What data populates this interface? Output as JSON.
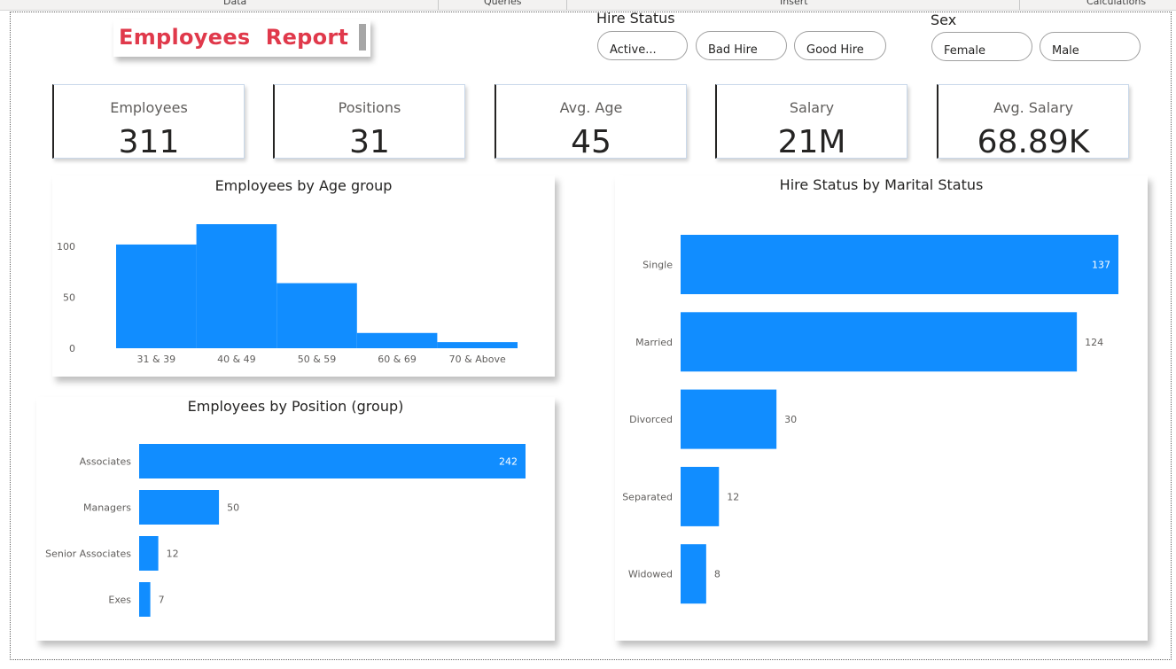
{
  "ribbon": {
    "tabs": [
      "Data",
      "Queries",
      "Insert",
      "Calculations"
    ]
  },
  "report": {
    "title": "Employees  Report"
  },
  "slicers": {
    "hire_status": {
      "title": "Hire Status",
      "options": [
        "Active...",
        "Bad Hire",
        "Good Hire"
      ]
    },
    "sex": {
      "title": "Sex",
      "options": [
        "Female",
        "Male"
      ]
    }
  },
  "kpis": [
    {
      "label": "Employees",
      "value": "311"
    },
    {
      "label": "Positions",
      "value": "31"
    },
    {
      "label": "Avg. Age",
      "value": "45"
    },
    {
      "label": "Salary",
      "value": "21M"
    },
    {
      "label": "Avg. Salary",
      "value": "68.89K"
    }
  ],
  "colors": {
    "bar": "#118dff",
    "title_red": "#e0394b"
  },
  "chart_data": [
    {
      "id": "age",
      "type": "bar",
      "title": "Employees by Age group",
      "categories": [
        "31 & 39",
        "40 & 49",
        "50 & 59",
        "60 & 69",
        "70 & Above"
      ],
      "values": [
        102,
        122,
        64,
        15,
        6
      ],
      "yticks": [
        0,
        50,
        100
      ],
      "ylim": [
        0,
        122
      ],
      "data_labels": false
    },
    {
      "id": "position",
      "type": "bar",
      "orientation": "horizontal",
      "title": "Employees by Position (group)",
      "categories": [
        "Associates",
        "Managers",
        "Senior Associates",
        "Exes"
      ],
      "values": [
        242,
        50,
        12,
        7
      ],
      "data_labels": true
    },
    {
      "id": "marital",
      "type": "bar",
      "orientation": "horizontal",
      "title": "Hire Status by Marital Status",
      "categories": [
        "Single",
        "Married",
        "Divorced",
        "Separated",
        "Widowed"
      ],
      "values": [
        137,
        124,
        30,
        12,
        8
      ],
      "data_labels": true
    }
  ]
}
